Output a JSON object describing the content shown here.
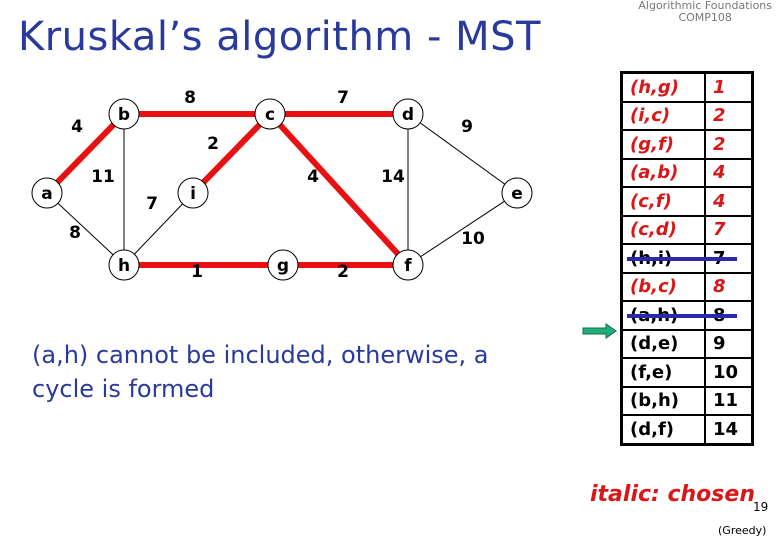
{
  "header": {
    "line1": "Algorithmic Foundations",
    "line2": "COMP108"
  },
  "title": "Kruskal’s algorithm - MST",
  "caption": "(a,h) cannot be included, otherwise, a cycle is formed",
  "graph": {
    "nodes": [
      "a",
      "b",
      "c",
      "d",
      "e",
      "f",
      "g",
      "h",
      "i"
    ],
    "edges": [
      {
        "u": "a",
        "v": "b",
        "w": "4",
        "chosen": true
      },
      {
        "u": "b",
        "v": "c",
        "w": "8",
        "chosen": true
      },
      {
        "u": "c",
        "v": "d",
        "w": "7",
        "chosen": true
      },
      {
        "u": "d",
        "v": "e",
        "w": "9",
        "chosen": false
      },
      {
        "u": "i",
        "v": "c",
        "w": "2",
        "chosen": true
      },
      {
        "u": "b",
        "v": "h",
        "w": "11",
        "chosen": false
      },
      {
        "u": "c",
        "v": "f",
        "w": "4",
        "chosen": true
      },
      {
        "u": "d",
        "v": "f",
        "w": "14",
        "chosen": false
      },
      {
        "u": "h",
        "v": "i",
        "w": "7",
        "chosen": false
      },
      {
        "u": "a",
        "v": "h",
        "w": "8",
        "chosen": false
      },
      {
        "u": "f",
        "v": "e",
        "w": "10",
        "chosen": false
      },
      {
        "u": "h",
        "v": "g",
        "w": "1",
        "chosen": true
      },
      {
        "u": "g",
        "v": "f",
        "w": "2",
        "chosen": true
      }
    ],
    "colors": {
      "chosen": "#e81010",
      "normal": "#000000"
    }
  },
  "table": {
    "rows": [
      {
        "edge": "(h,g)",
        "weight": "1",
        "status": "chosen"
      },
      {
        "edge": "(i,c)",
        "weight": "2",
        "status": "chosen"
      },
      {
        "edge": "(g,f)",
        "weight": "2",
        "status": "chosen"
      },
      {
        "edge": "(a,b)",
        "weight": "4",
        "status": "chosen"
      },
      {
        "edge": "(c,f)",
        "weight": "4",
        "status": "chosen"
      },
      {
        "edge": "(c,d)",
        "weight": "7",
        "status": "chosen"
      },
      {
        "edge": "(h,i)",
        "weight": "7",
        "status": "rejected"
      },
      {
        "edge": "(b,c)",
        "weight": "8",
        "status": "chosen"
      },
      {
        "edge": "(a,h)",
        "weight": "8",
        "status": "rejected"
      },
      {
        "edge": "(d,e)",
        "weight": "9",
        "status": "pending"
      },
      {
        "edge": "(f,e)",
        "weight": "10",
        "status": "pending"
      },
      {
        "edge": "(b,h)",
        "weight": "11",
        "status": "pending"
      },
      {
        "edge": "(d,f)",
        "weight": "14",
        "status": "pending"
      }
    ],
    "current_row": "(a,h)",
    "arrow_color": "#1fae7a",
    "strike_color": "#2a2aa8"
  },
  "legend": "italic: chosen",
  "page_number": "19",
  "footer": "(Greedy)"
}
